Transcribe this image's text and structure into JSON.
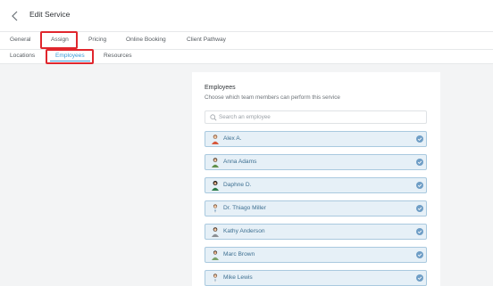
{
  "header": {
    "title": "Edit Service"
  },
  "tabs": [
    "General",
    "Assign",
    "Pricing",
    "Online Booking",
    "Client Pathway"
  ],
  "subtabs": [
    "Locations",
    "Employees",
    "Resources"
  ],
  "panel": {
    "title": "Employees",
    "subtitle": "Choose which team members can perform this service",
    "search_placeholder": "Search an employee"
  },
  "employees": [
    {
      "name": "Alex A.",
      "selected": true
    },
    {
      "name": "Anna Adams",
      "selected": true
    },
    {
      "name": "Daphne D.",
      "selected": true
    },
    {
      "name": "Dr. Thiago Miller",
      "selected": true
    },
    {
      "name": "Kathy Anderson",
      "selected": true
    },
    {
      "name": "Marc Brown",
      "selected": true
    },
    {
      "name": "Mike Lewis",
      "selected": true
    }
  ],
  "colors": {
    "accent": "#3a9bd8",
    "highlight": "#e0262d",
    "selected_bg": "#e6f0f7",
    "check": "#6f9ec6"
  }
}
